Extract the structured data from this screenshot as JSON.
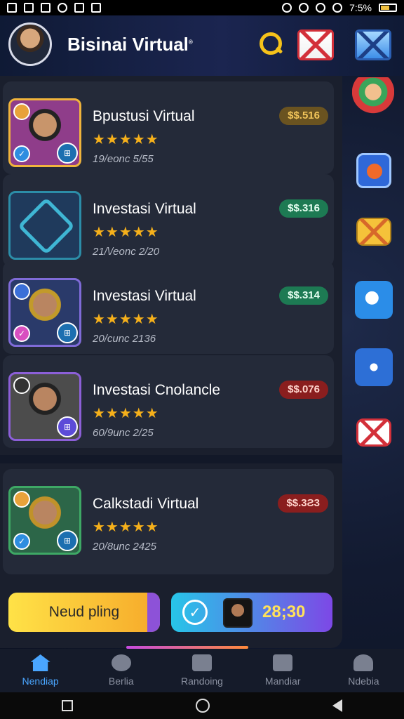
{
  "status_bar": {
    "time_battery": "7:5%"
  },
  "header": {
    "title": "Bisinai Virtual"
  },
  "cards": [
    {
      "title": "Bpustusi Virtual",
      "stars": "★★★★★",
      "meta": "19/eonc  5/55",
      "price": "$$.516",
      "price_color": "#6a5320"
    },
    {
      "title": "Investasi Virtual",
      "stars": "★★★★★",
      "meta": "21/\\/eonc  2/20",
      "price": "$$.316",
      "price_color": "#1d7a53"
    },
    {
      "title": "Investasi Virtual",
      "stars": "★★★★★",
      "meta": "20/cunc  2136",
      "price": "$$.314",
      "price_color": "#1d7a53"
    },
    {
      "title": "Investasi Cnolancle",
      "stars": "★★★★★",
      "meta": "60/9unc  2/25",
      "price": "$$.076",
      "price_color": "#8a1e1e"
    },
    {
      "title": "Calkstadi Virtual",
      "stars": "★★★★★",
      "meta": "20/8unc  2425",
      "price": "$$.3Ƨ3",
      "price_color": "#8a1e1e"
    }
  ],
  "actions": {
    "left_button": "Neud pling",
    "right_time": "28;30"
  },
  "nav": [
    {
      "label": "Nendiap",
      "icon": "home-icon",
      "active": true
    },
    {
      "label": "Berlia",
      "icon": "gear-icon",
      "active": false
    },
    {
      "label": "Randoing",
      "icon": "box-icon",
      "active": false
    },
    {
      "label": "Mandiar",
      "icon": "calendar-icon",
      "active": false
    },
    {
      "label": "Ndebia",
      "icon": "person-icon",
      "active": false
    }
  ],
  "colors": {
    "accent": "#4aa6ff",
    "star": "#f5b01b",
    "search": "#f6c21a"
  }
}
